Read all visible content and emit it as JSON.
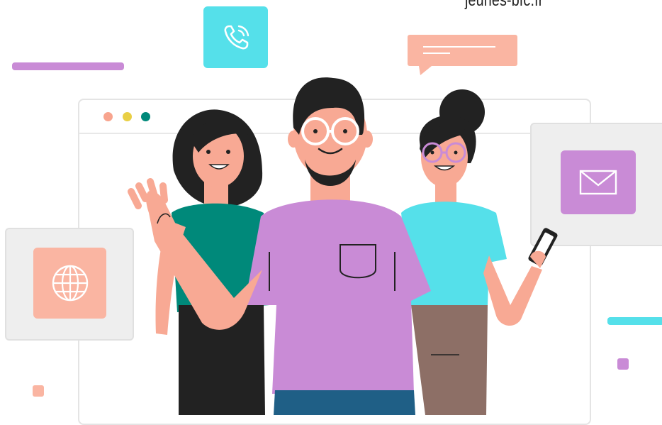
{
  "header": {
    "site_text": "jeunes-bfc.fr"
  },
  "colors": {
    "purple": "#c98bd6",
    "cyan": "#55e0ea",
    "salmon": "#fab5a2",
    "teal": "#00897a",
    "skin": "#f8a994",
    "hair": "#222222",
    "brown": "#8d6f66",
    "navy": "#1f5f86",
    "dot_red": "#f8a48e",
    "dot_yellow": "#e9cf45",
    "dot_green": "#00897a"
  },
  "icons": {
    "phone": "phone-icon",
    "mail": "mail-icon",
    "globe": "globe-icon",
    "chat": "chat-bubble-icon",
    "smartphone": "smartphone-icon"
  }
}
